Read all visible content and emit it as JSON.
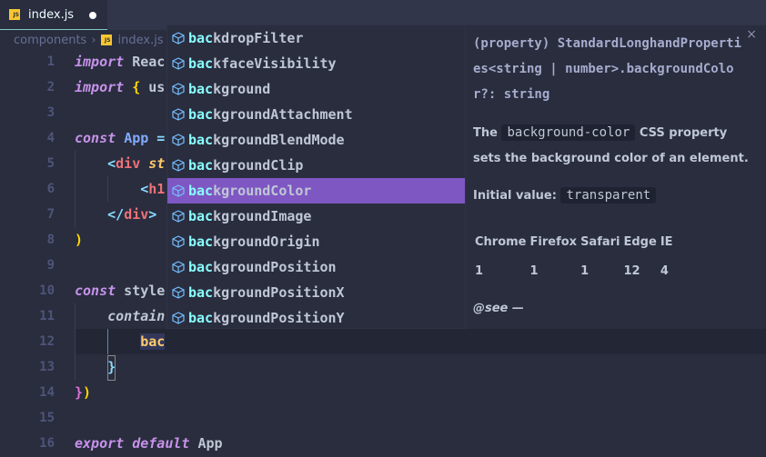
{
  "tab": {
    "filename": "index.js",
    "icon": "js-file-icon",
    "modified": true
  },
  "breadcrumb": [
    "components",
    "index.js"
  ],
  "line_numbers": [
    "1",
    "2",
    "3",
    "4",
    "5",
    "6",
    "7",
    "8",
    "9",
    "10",
    "11",
    "12",
    "13",
    "14",
    "15",
    "16"
  ],
  "code": {
    "l1": [
      "import",
      " Reac"
    ],
    "l2": [
      "import",
      " ",
      "{",
      " us"
    ],
    "l4": [
      "const",
      " ",
      "App",
      " ="
    ],
    "l5": [
      "    ",
      "<",
      "div",
      " st"
    ],
    "l6": [
      "        ",
      "<",
      "h1"
    ],
    "l7": [
      "    ",
      "</",
      "div",
      ">"
    ],
    "l8": [
      ")"
    ],
    "l10": [
      "const",
      " style"
    ],
    "l11": [
      "    ",
      "contain"
    ],
    "l12": [
      "        ",
      "bac"
    ],
    "l13": [
      "    ",
      "}"
    ],
    "l14": [
      "}",
      ")"
    ],
    "l16": [
      "export",
      " ",
      "default",
      " App"
    ]
  },
  "suggestions": {
    "match": "bac",
    "items": [
      "kdropFilter",
      "kfaceVisibility",
      "kground",
      "kgroundAttachment",
      "kgroundBlendMode",
      "kgroundClip",
      "kgroundColor",
      "kgroundImage",
      "kgroundOrigin",
      "kgroundPosition",
      "kgroundPositionX",
      "kgroundPositionY"
    ],
    "selected_index": 6,
    "item_icon": "property-cube-icon",
    "selection_color": "#7e57c2"
  },
  "docs": {
    "signature": "(property) StandardLonghandProperties<string | number>.backgroundColor?:  string",
    "desc_pre": "The ",
    "desc_code": "background-color",
    "desc_post": " CSS property sets the background color of an element.",
    "initial_label": "Initial value:",
    "initial_value": "transparent",
    "compat_headers": [
      "Chrome",
      "Firefox",
      "Safari",
      "Edge",
      "IE"
    ],
    "compat_values": [
      "1",
      "1",
      "1",
      "12",
      "4"
    ],
    "see": "@see —",
    "close": "×"
  }
}
